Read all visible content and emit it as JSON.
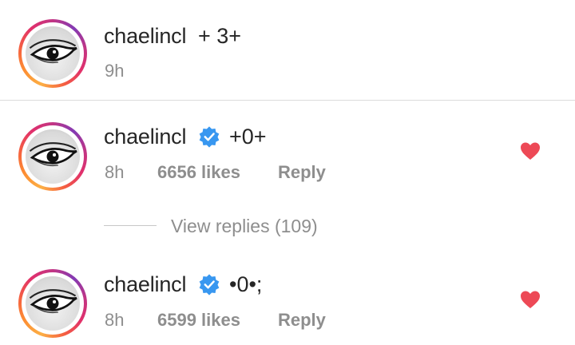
{
  "comments": [
    {
      "username": "chaelincl",
      "verified": false,
      "text": "+ 3+",
      "time": "9h",
      "likes": "",
      "reply": "",
      "liked": false,
      "avatar_icon": "eye-avatar-icon"
    },
    {
      "username": "chaelincl",
      "verified": true,
      "text": "+0+",
      "time": "8h",
      "likes": "6656 likes",
      "reply": "Reply",
      "liked": true,
      "avatar_icon": "eye-avatar-icon"
    },
    {
      "username": "chaelincl",
      "verified": true,
      "text": "•0•;",
      "time": "8h",
      "likes": "6599 likes",
      "reply": "Reply",
      "liked": true,
      "avatar_icon": "eye-avatar-icon"
    }
  ],
  "view_replies": "View replies (109)",
  "colors": {
    "verified_blue": "#3897f0",
    "heart_red": "#ed4956",
    "meta_gray": "#8e8e8e",
    "text_dark": "#262626"
  }
}
